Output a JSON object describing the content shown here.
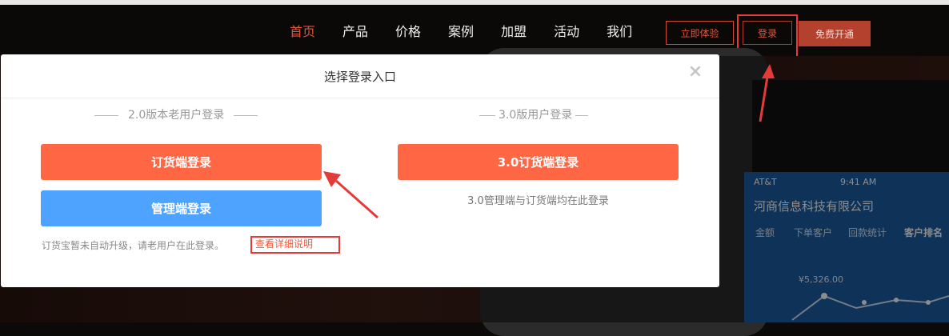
{
  "header": {
    "nav": [
      "首页",
      "产品",
      "价格",
      "案例",
      "加盟",
      "活动",
      "我们"
    ],
    "try_label": "立即体验",
    "login_label": "登录",
    "free_label": "免费开通"
  },
  "background": {
    "carrier": "AT&T",
    "time": "9:41 AM",
    "company": "河商信息科技有限公司",
    "tabs": [
      "金额",
      "下单客户",
      "回款统计",
      "客户排名"
    ],
    "amount": "¥5,326.00"
  },
  "modal": {
    "title": "选择登录入口",
    "close_label": "×",
    "v2": {
      "heading": "2.0版本老用户登录",
      "order_button": "订货端登录",
      "admin_button": "管理端登录",
      "note": "订货宝暂未自动升级，请老用户在此登录。",
      "detail_link": "查看详细说明"
    },
    "v3": {
      "heading": "3.0版用户登录",
      "button": "3.0订货端登录",
      "note": "3.0管理端与订货端均在此登录"
    }
  },
  "colors": {
    "accent_orange": "#ff6644",
    "admin_blue": "#4da3ff",
    "annotation_red": "#e53a3a"
  }
}
